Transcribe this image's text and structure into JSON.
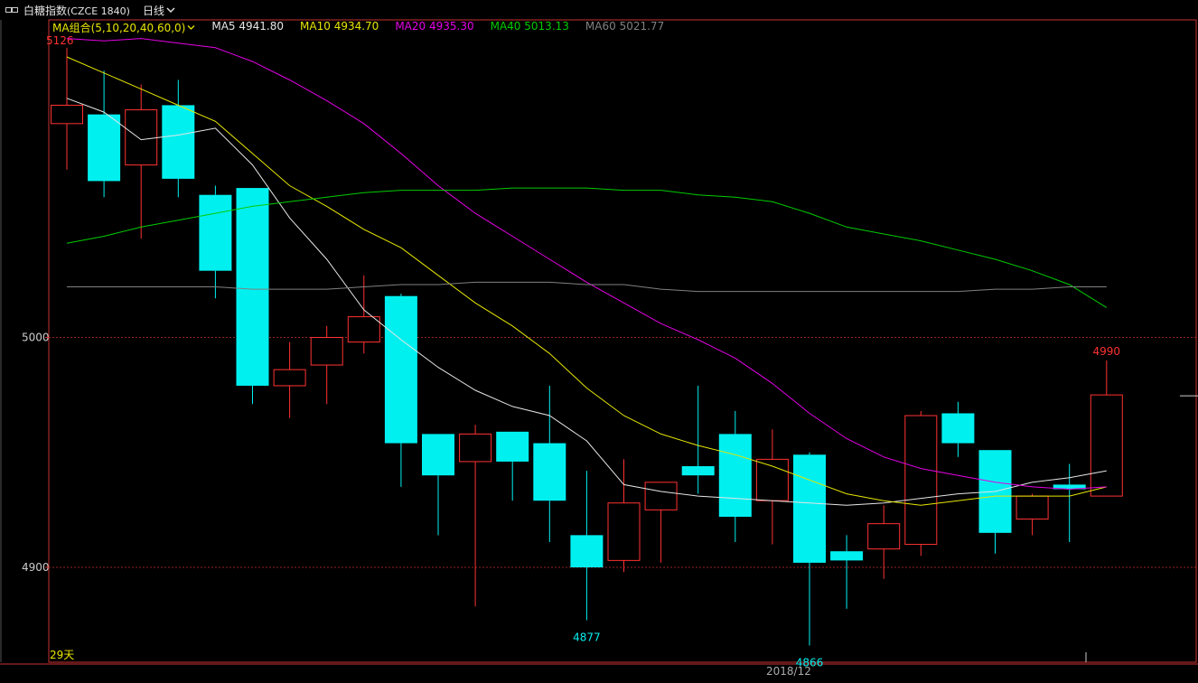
{
  "window": {
    "title": "白糖指数",
    "code": "(CZCE 1840)",
    "period": "日线"
  },
  "legend": {
    "combo": "MA组合(5,10,20,40,60,0)",
    "items": [
      {
        "name": "MA5",
        "value": "4941.80",
        "color": "#e6e6e6"
      },
      {
        "name": "MA10",
        "value": "4934.70",
        "color": "#e6e600"
      },
      {
        "name": "MA20",
        "value": "4935.30",
        "color": "#e600e6"
      },
      {
        "name": "MA40",
        "value": "5013.13",
        "color": "#00cc00"
      },
      {
        "name": "MA60",
        "value": "5021.77",
        "color": "#808080"
      }
    ]
  },
  "footer": {
    "day_count": "29天",
    "date": "2018/12"
  },
  "colors": {
    "up": "#ff3232",
    "down": "#00f0f0",
    "background": "#000000",
    "axis": "#c83232"
  },
  "chart_data": {
    "type": "candlestick",
    "ylim": [
      4860,
      5135
    ],
    "yticks": [
      4900,
      5000
    ],
    "y_tick_labels": [
      "4900",
      "5000"
    ],
    "top_label": "5126",
    "candles": [
      {
        "o": 5093,
        "h": 5126,
        "l": 5073,
        "c": 5101
      },
      {
        "o": 5097,
        "h": 5116,
        "l": 5061,
        "c": 5068
      },
      {
        "o": 5075,
        "h": 5110,
        "l": 5043,
        "c": 5099
      },
      {
        "o": 5101,
        "h": 5112,
        "l": 5061,
        "c": 5069
      },
      {
        "o": 5062,
        "h": 5066,
        "l": 5017,
        "c": 5029
      },
      {
        "o": 5065,
        "h": 5065,
        "l": 4971,
        "c": 4979
      },
      {
        "o": 4979,
        "h": 4998,
        "l": 4965,
        "c": 4986
      },
      {
        "o": 4988,
        "h": 5005,
        "l": 4971,
        "c": 5000
      },
      {
        "o": 4998,
        "h": 5027,
        "l": 4993,
        "c": 5009
      },
      {
        "o": 5018,
        "h": 5019,
        "l": 4935,
        "c": 4954
      },
      {
        "o": 4958,
        "h": 4958,
        "l": 4914,
        "c": 4940
      },
      {
        "o": 4946,
        "h": 4962,
        "l": 4883,
        "c": 4958
      },
      {
        "o": 4959,
        "h": 4959,
        "l": 4929,
        "c": 4946
      },
      {
        "o": 4954,
        "h": 4979,
        "l": 4911,
        "c": 4929
      },
      {
        "o": 4914,
        "h": 4942,
        "l": 4877,
        "c": 4900
      },
      {
        "o": 4903,
        "h": 4947,
        "l": 4898,
        "c": 4928
      },
      {
        "o": 4925,
        "h": 4937,
        "l": 4902,
        "c": 4937
      },
      {
        "o": 4944,
        "h": 4979,
        "l": 4932,
        "c": 4940
      },
      {
        "o": 4958,
        "h": 4968,
        "l": 4911,
        "c": 4922
      },
      {
        "o": 4929,
        "h": 4960,
        "l": 4910,
        "c": 4947
      },
      {
        "o": 4949,
        "h": 4950,
        "l": 4866,
        "c": 4902
      },
      {
        "o": 4907,
        "h": 4914,
        "l": 4882,
        "c": 4903
      },
      {
        "o": 4908,
        "h": 4927,
        "l": 4895,
        "c": 4919
      },
      {
        "o": 4910,
        "h": 4968,
        "l": 4905,
        "c": 4966
      },
      {
        "o": 4967,
        "h": 4972,
        "l": 4948,
        "c": 4954
      },
      {
        "o": 4951,
        "h": 4951,
        "l": 4906,
        "c": 4915
      },
      {
        "o": 4921,
        "h": 4932,
        "l": 4914,
        "c": 4931
      },
      {
        "o": 4936,
        "h": 4945,
        "l": 4911,
        "c": 4934
      },
      {
        "o": 4931,
        "h": 4990,
        "l": 4931,
        "c": 4975
      }
    ],
    "annotations": [
      {
        "index": 14,
        "value": 4877,
        "label": "4877",
        "color": "#00f0f0"
      },
      {
        "index": 20,
        "value": 4866,
        "label": "4866",
        "color": "#00f0f0"
      },
      {
        "index": 28,
        "value": 4990,
        "label": "4990",
        "color": "#ff3232"
      }
    ],
    "series": [
      {
        "name": "MA5",
        "color": "#e6e6e6",
        "values": [
          5104,
          5098,
          5086,
          5088,
          5091,
          5075,
          5052,
          5034,
          5012,
          4999,
          4987,
          4977,
          4970,
          4966,
          4955,
          4936,
          4933,
          4931,
          4930,
          4929,
          4928,
          4927,
          4928,
          4930,
          4932,
          4933,
          4937,
          4939,
          4942
        ]
      },
      {
        "name": "MA10",
        "color": "#e6e600",
        "values": [
          5122,
          5115,
          5108,
          5101,
          5094,
          5080,
          5066,
          5057,
          5047,
          5039,
          5027,
          5015,
          5005,
          4993,
          4978,
          4966,
          4958,
          4953,
          4949,
          4944,
          4938,
          4932,
          4929,
          4927,
          4929,
          4931,
          4931,
          4931,
          4935
        ]
      },
      {
        "name": "MA20",
        "color": "#e600e6",
        "values": [
          5130,
          5129,
          5130,
          5128,
          5126,
          5120,
          5112,
          5103,
          5093,
          5080,
          5066,
          5054,
          5044,
          5034,
          5024,
          5015,
          5006,
          4999,
          4991,
          4980,
          4967,
          4956,
          4948,
          4943,
          4940,
          4937,
          4935,
          4934,
          4935
        ]
      },
      {
        "name": "MA40",
        "color": "#00cc00",
        "values": [
          5041,
          5044,
          5048,
          5051,
          5054,
          5057,
          5059,
          5061,
          5063,
          5064,
          5064,
          5064,
          5065,
          5065,
          5065,
          5064,
          5064,
          5062,
          5061,
          5059,
          5054,
          5048,
          5045,
          5042,
          5038,
          5034,
          5029,
          5023,
          5013
        ]
      },
      {
        "name": "MA60",
        "color": "#808080",
        "values": [
          5022,
          5022,
          5022,
          5022,
          5022,
          5021,
          5021,
          5021,
          5022,
          5023,
          5023,
          5024,
          5024,
          5024,
          5023,
          5023,
          5021,
          5020,
          5020,
          5020,
          5020,
          5020,
          5020,
          5020,
          5020,
          5021,
          5021,
          5022,
          5022
        ]
      }
    ]
  }
}
